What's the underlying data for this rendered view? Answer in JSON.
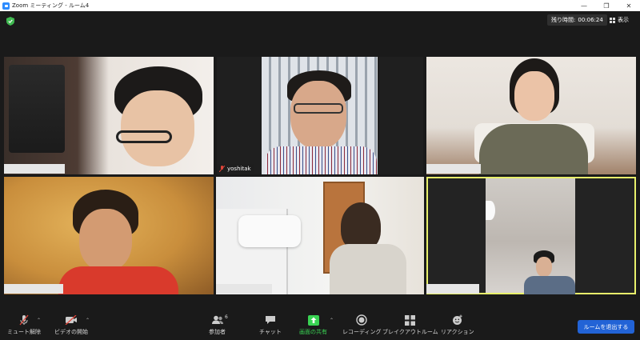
{
  "window": {
    "title": "Zoom ミーティング - ルーム4",
    "controls": [
      "minimize",
      "maximize",
      "close"
    ]
  },
  "header": {
    "timer_label": "残り時間:",
    "timer_value": "00:06:24",
    "view_label": "表示"
  },
  "tiles": [
    {
      "name": "",
      "icon": "none"
    },
    {
      "name": "yoshitak",
      "icon": "muted-mic-icon"
    },
    {
      "name": "",
      "icon": "none"
    },
    {
      "name": "",
      "icon": "none"
    },
    {
      "name": "",
      "icon": "none"
    },
    {
      "name": "",
      "icon": "none",
      "active": true
    }
  ],
  "toolbar": {
    "mute_label": "ミュート解除",
    "video_label": "ビデオの開始",
    "participants_label": "参加者",
    "participants_count": "6",
    "chat_label": "チャット",
    "share_label": "画面の共有",
    "record_label": "レコーディング",
    "breakout_label": "ブレイクアウトルーム",
    "reactions_label": "リアクション",
    "leave_label": "ルームを退出する"
  },
  "colors": {
    "share_green": "#39d353",
    "leave_blue": "#2263d6",
    "active_speaker": "#e8f06b",
    "muted_red": "#e0453a"
  }
}
